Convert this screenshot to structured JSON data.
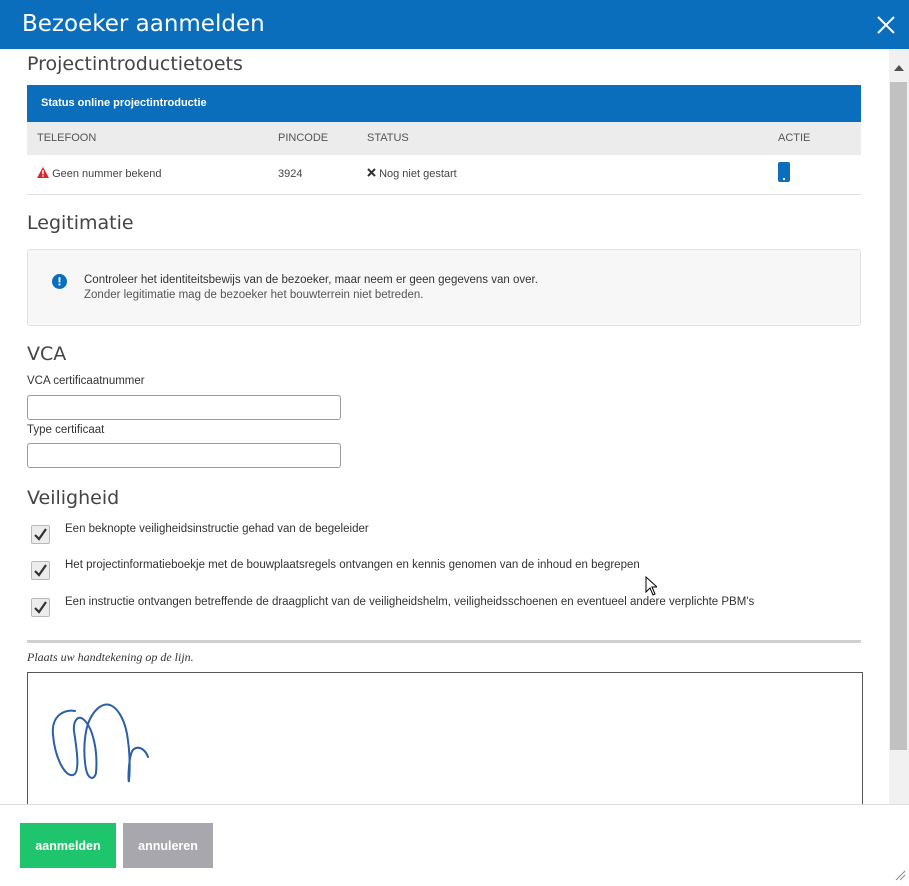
{
  "dialog": {
    "title": "Bezoeker aanmelden"
  },
  "project_intro": {
    "heading": "Projectintroductietoets",
    "status_header": "Status online projectintroductie",
    "columns": [
      "TELEFOON",
      "PINCODE",
      "STATUS",
      "ACTIE"
    ],
    "row": {
      "phone": "Geen nummer bekend",
      "pincode": "3924",
      "status": "Nog niet gestart"
    }
  },
  "legitimatie": {
    "heading": "Legitimatie",
    "info_line1": "Controleer het identiteitsbewijs van de bezoeker, maar neem er geen gegevens van over.",
    "info_line2": "Zonder legitimatie mag de bezoeker het bouwterrein niet betreden."
  },
  "vca": {
    "heading": "VCA",
    "cert_number_label": "VCA certificaatnummer",
    "cert_number_value": "",
    "cert_type_label": "Type certificaat",
    "cert_type_value": ""
  },
  "veiligheid": {
    "heading": "Veiligheid",
    "items": [
      {
        "label": "Een beknopte veiligheidsinstructie gehad van de begeleider",
        "checked": true
      },
      {
        "label": "Het projectinformatieboekje met de bouwplaatsregels ontvangen en kennis genomen van de inhoud en begrepen",
        "checked": true
      },
      {
        "label": "Een instructie ontvangen betreffende de draagplicht van de veiligheidshelm, veiligheidsschoenen en eventueel andere verplichte PBM's",
        "checked": true
      }
    ]
  },
  "signature": {
    "caption": "Plaats uw handtekening op de lijn."
  },
  "footer": {
    "submit_label": "aanmelden",
    "cancel_label": "annuleren"
  },
  "colors": {
    "header_blue": "#0a6ebd",
    "submit_green": "#1fc56c",
    "cancel_gray": "#a7a7ad",
    "warning_red": "#d9262e",
    "signature_ink": "#2b5fa6"
  }
}
